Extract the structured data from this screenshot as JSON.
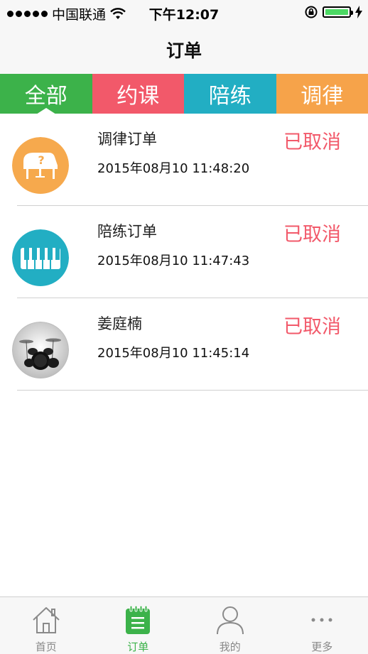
{
  "status_bar": {
    "carrier": "中国联通",
    "time": "下午12:07"
  },
  "nav": {
    "title": "订单"
  },
  "filter_tabs": [
    {
      "label": "全部",
      "active": true,
      "color": "#3cb24a"
    },
    {
      "label": "约课",
      "active": false,
      "color": "#f2596a"
    },
    {
      "label": "陪练",
      "active": false,
      "color": "#22aec3"
    },
    {
      "label": "调律",
      "active": false,
      "color": "#f6a34a"
    }
  ],
  "orders": [
    {
      "title": "调律订单",
      "time": "2015年08月10 11:48:20",
      "status": "已取消",
      "icon": "piano-question-icon"
    },
    {
      "title": "陪练订单",
      "time": "2015年08月10 11:47:43",
      "status": "已取消",
      "icon": "piano-keys-icon"
    },
    {
      "title": "姜庭楠",
      "time": "2015年08月10 11:45:14",
      "status": "已取消",
      "icon": "drum-kit-photo"
    }
  ],
  "tab_bar": [
    {
      "label": "首页",
      "icon": "home-icon",
      "active": false
    },
    {
      "label": "订单",
      "icon": "order-notepad-icon",
      "active": true
    },
    {
      "label": "我的",
      "icon": "person-icon",
      "active": false
    },
    {
      "label": "更多",
      "icon": "more-dots-icon",
      "active": false
    }
  ],
  "colors": {
    "accent_green": "#3cb24a",
    "status_red": "#f2596a"
  }
}
